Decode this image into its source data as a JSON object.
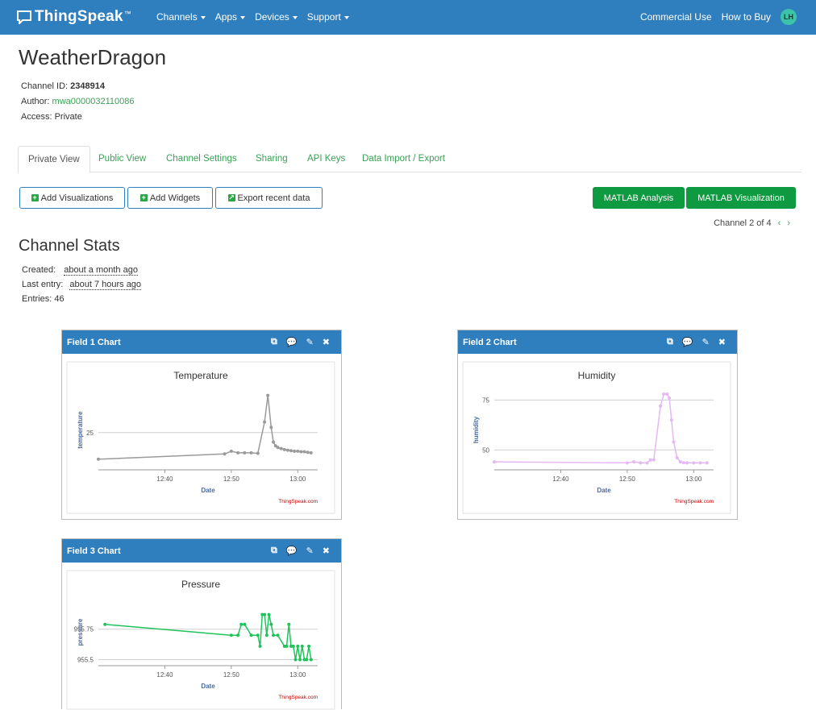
{
  "nav": {
    "brand": "ThingSpeak",
    "tm": "™",
    "menu": [
      "Channels",
      "Apps",
      "Devices",
      "Support"
    ],
    "right": [
      "Commercial Use",
      "How to Buy"
    ],
    "avatar": "LH"
  },
  "channel": {
    "title": "WeatherDragon",
    "id_label": "Channel ID:",
    "id_value": "2348914",
    "author_label": "Author:",
    "author_value": "mwa0000032110086",
    "access_label": "Access:",
    "access_value": "Private"
  },
  "tabs": [
    "Private View",
    "Public View",
    "Channel Settings",
    "Sharing",
    "API Keys",
    "Data Import / Export"
  ],
  "actions": {
    "add_visualizations": "Add Visualizations",
    "add_widgets": "Add Widgets",
    "export": "Export recent data",
    "matlab_analysis": "MATLAB Analysis",
    "matlab_visualization": "MATLAB Visualization"
  },
  "pager": {
    "text": "Channel 2 of 4",
    "prev": "‹",
    "next": "›"
  },
  "stats": {
    "title": "Channel Stats",
    "created_label": "Created:",
    "created_value": "about a month ago",
    "last_label": "Last entry:",
    "last_value": "about 7 hours ago",
    "entries": "Entries: 46"
  },
  "widget_tools": {
    "popout": "⧉",
    "comment": "💬",
    "edit": "✎",
    "close": "✖"
  },
  "colors": {
    "navbar": "#2f7ebe",
    "link": "#3aa056",
    "button_green": "#0e9a40"
  },
  "chart_data": [
    {
      "type": "line",
      "panel_title": "Field 1 Chart",
      "title": "Temperature",
      "xlabel": "Date",
      "ylabel": "temperature",
      "credit": "ThingSpeak.com",
      "color": "#9a9a9a",
      "xlim": [
        "12:30",
        "13:03"
      ],
      "ylim": [
        18,
        33
      ],
      "ytick_values": [
        25
      ],
      "ytick_labels": [
        "25"
      ],
      "xticks": [
        "12:40",
        "12:50",
        "13:00"
      ],
      "x": [
        "12:30",
        "12:49",
        "12:50",
        "12:51",
        "12:52",
        "12:53",
        "12:54",
        "12:55",
        "12:55:30",
        "12:56",
        "12:56:20",
        "12:56:40",
        "12:57",
        "12:57:30",
        "12:58",
        "12:58:30",
        "12:59",
        "12:59:30",
        "13:00",
        "13:00:30",
        "13:01",
        "13:01:30",
        "13:02"
      ],
      "y": [
        20,
        21,
        21.5,
        21.2,
        21.2,
        21.2,
        21.1,
        27,
        32,
        26,
        23.2,
        22.5,
        22.2,
        22,
        21.8,
        21.7,
        21.6,
        21.5,
        21.5,
        21.4,
        21.4,
        21.3,
        21.2
      ]
    },
    {
      "type": "line",
      "panel_title": "Field 2 Chart",
      "title": "Humidity",
      "xlabel": "Date",
      "ylabel": "humidity",
      "credit": "ThingSpeak.com",
      "color": "#e6b8f2",
      "xlim": [
        "12:30",
        "13:03"
      ],
      "ylim": [
        40,
        80
      ],
      "ytick_values": [
        50,
        75
      ],
      "ytick_labels": [
        "50",
        "75"
      ],
      "xticks": [
        "12:40",
        "12:50",
        "13:00"
      ],
      "x": [
        "12:30",
        "12:50",
        "12:51",
        "12:52",
        "12:53",
        "12:53:30",
        "12:54",
        "12:55",
        "12:55:30",
        "12:56",
        "12:56:20",
        "12:56:40",
        "12:57",
        "12:57:30",
        "12:58",
        "12:58:30",
        "12:59",
        "13:00",
        "13:01",
        "13:02"
      ],
      "y": [
        44,
        43.5,
        44,
        43.5,
        43.5,
        45,
        45,
        72,
        78,
        78,
        76,
        65,
        54,
        46,
        44,
        43.6,
        43.5,
        43.5,
        43.5,
        43.5
      ]
    },
    {
      "type": "line",
      "panel_title": "Field 3 Chart",
      "title": "Pressure",
      "xlabel": "Date",
      "ylabel": "pressure",
      "credit": "ThingSpeak.com",
      "color": "#1ec45a",
      "xlim": [
        "12:30",
        "13:03"
      ],
      "ylim": [
        955.45,
        956.0
      ],
      "ytick_values": [
        955.5,
        955.75
      ],
      "ytick_labels": [
        "955.5",
        "955.75"
      ],
      "xticks": [
        "12:40",
        "12:50",
        "13:00"
      ],
      "x": [
        "12:31",
        "12:50",
        "12:51",
        "12:51:30",
        "12:52",
        "12:53",
        "12:54",
        "12:54:20",
        "12:54:40",
        "12:55",
        "12:55:20",
        "12:55:40",
        "12:56",
        "12:56:20",
        "12:57",
        "12:58",
        "12:58:20",
        "12:58:40",
        "12:59",
        "12:59:20",
        "12:59:40",
        "13:00",
        "13:00:20",
        "13:00:40",
        "13:01",
        "13:01:20",
        "13:01:40",
        "13:02"
      ],
      "y": [
        955.79,
        955.7,
        955.7,
        955.79,
        955.79,
        955.7,
        955.7,
        955.61,
        955.87,
        955.87,
        955.7,
        955.87,
        955.79,
        955.7,
        955.7,
        955.61,
        955.61,
        955.79,
        955.61,
        955.61,
        955.5,
        955.61,
        955.5,
        955.61,
        955.5,
        955.5,
        955.61,
        955.5
      ]
    }
  ]
}
